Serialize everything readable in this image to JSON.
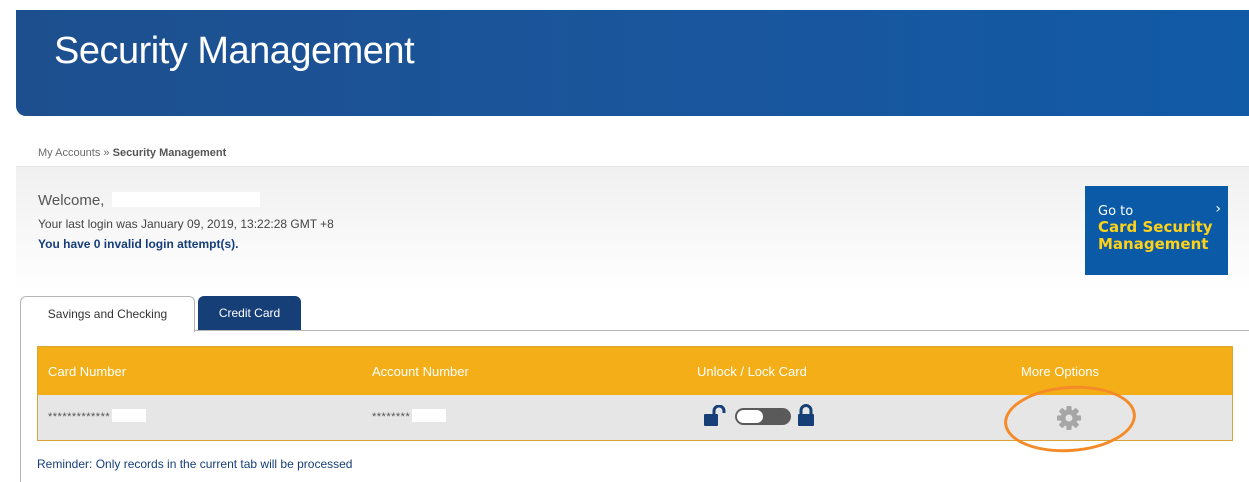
{
  "header": {
    "title": "Security Management"
  },
  "breadcrumb": {
    "parent": "My Accounts",
    "separator": "»",
    "current": "Security Management"
  },
  "welcome": {
    "greeting": "Welcome,",
    "last_login": "Your last login was January 09, 2019, 13:22:28 GMT +8",
    "invalid_attempts": "You have 0 invalid login attempt(s)."
  },
  "card_security_button": {
    "line1": "Go to",
    "line2": "Card Security",
    "line3": "Management",
    "arrow": "›"
  },
  "tabs": [
    {
      "label": "Savings and Checking",
      "active": true
    },
    {
      "label": "Credit Card",
      "active": false
    }
  ],
  "table": {
    "columns": [
      "Card Number",
      "Account Number",
      "Unlock / Lock Card",
      "More Options"
    ],
    "rows": [
      {
        "card_number": "*************",
        "account_number": "********",
        "locked": true
      }
    ]
  },
  "reminder": "Reminder: Only records in the current tab will be processed",
  "colors": {
    "banner": "#1a569d",
    "table_header": "#f4ae17",
    "card_button": "#0b5aa8",
    "card_button_accent": "#ffd21a",
    "highlight": "#f58a28"
  }
}
